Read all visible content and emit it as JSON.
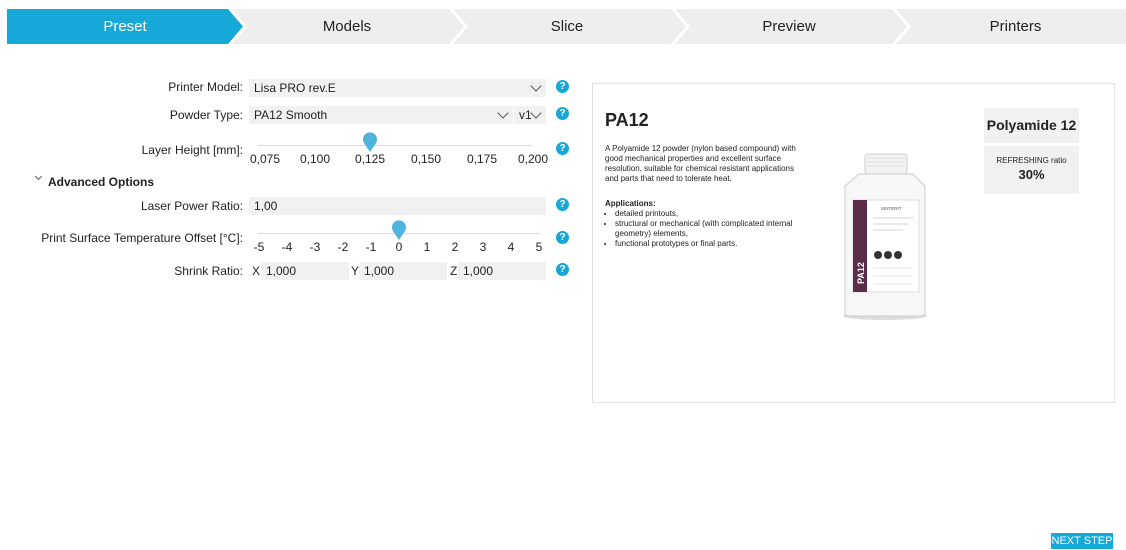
{
  "steps": [
    {
      "label": "Preset",
      "active": true
    },
    {
      "label": "Models",
      "active": false
    },
    {
      "label": "Slice",
      "active": false
    },
    {
      "label": "Preview",
      "active": false
    },
    {
      "label": "Printers",
      "active": false
    }
  ],
  "form": {
    "printer_model": {
      "label": "Printer Model:",
      "value": "Lisa PRO rev.E"
    },
    "powder_type": {
      "label": "Powder Type:",
      "value": "PA12 Smooth",
      "version": "v1"
    },
    "layer_height": {
      "label": "Layer Height [mm]:",
      "ticks": [
        "0,075",
        "0,100",
        "0,125",
        "0,150",
        "0,175",
        "0,200"
      ],
      "selected": "0,125"
    },
    "advanced_label": "Advanced Options",
    "laser_power": {
      "label": "Laser Power Ratio:",
      "value": "1,00"
    },
    "temp_offset": {
      "label": "Print Surface Temperature Offset [°C]:",
      "ticks": [
        "-5",
        "-4",
        "-3",
        "-2",
        "-1",
        "0",
        "1",
        "2",
        "3",
        "4",
        "5"
      ],
      "selected": "0"
    },
    "shrink": {
      "label": "Shrink Ratio:",
      "x_label": "X",
      "x": "1,000",
      "y_label": "Y",
      "y": "1,000",
      "z_label": "Z",
      "z": "1,000"
    },
    "help_glyph": "?"
  },
  "material": {
    "name": "PA12",
    "description": "A Polyamide 12 powder (nylon based compound) with good mechanical properties and excellent surface resolution, suitable for chemical resistant applications and parts that need to tolerate heat.",
    "applications_title": "Applications:",
    "applications": [
      "detailed printouts,",
      "structural or mechanical (with complicated internal geometry) elements,",
      "functional prototypes or final parts."
    ],
    "badge_title": "Polyamide 12",
    "refreshing_label": "REFRESHING ratio",
    "refreshing_value": "30%",
    "bottle_label": "PA12",
    "bottle_brand": "SINTERIT"
  },
  "next_step": "NEXT STEP",
  "colors": {
    "accent": "#16a9d8",
    "step_bg": "#eeeeee",
    "field_bg": "#f1f1f1",
    "slider_thumb": "#4fb3e0"
  }
}
